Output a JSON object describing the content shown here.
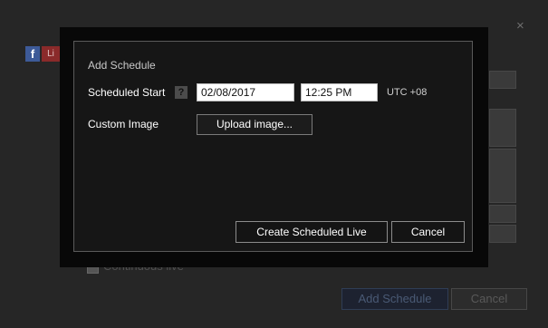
{
  "background": {
    "close_glyph": "×",
    "fb_glyph": "f",
    "yt_glyph": "Li",
    "continuous_label": "Continuous live",
    "add_schedule_label": "Add Schedule",
    "cancel_label": "Cancel"
  },
  "modal": {
    "title": "Add Schedule",
    "scheduled_start_label": "Scheduled Start",
    "help_glyph": "?",
    "date_value": "02/08/2017",
    "time_value": "12:25 PM",
    "timezone": "UTC +08",
    "custom_image_label": "Custom Image",
    "upload_label": "Upload image...",
    "create_label": "Create Scheduled Live",
    "cancel_label": "Cancel"
  }
}
